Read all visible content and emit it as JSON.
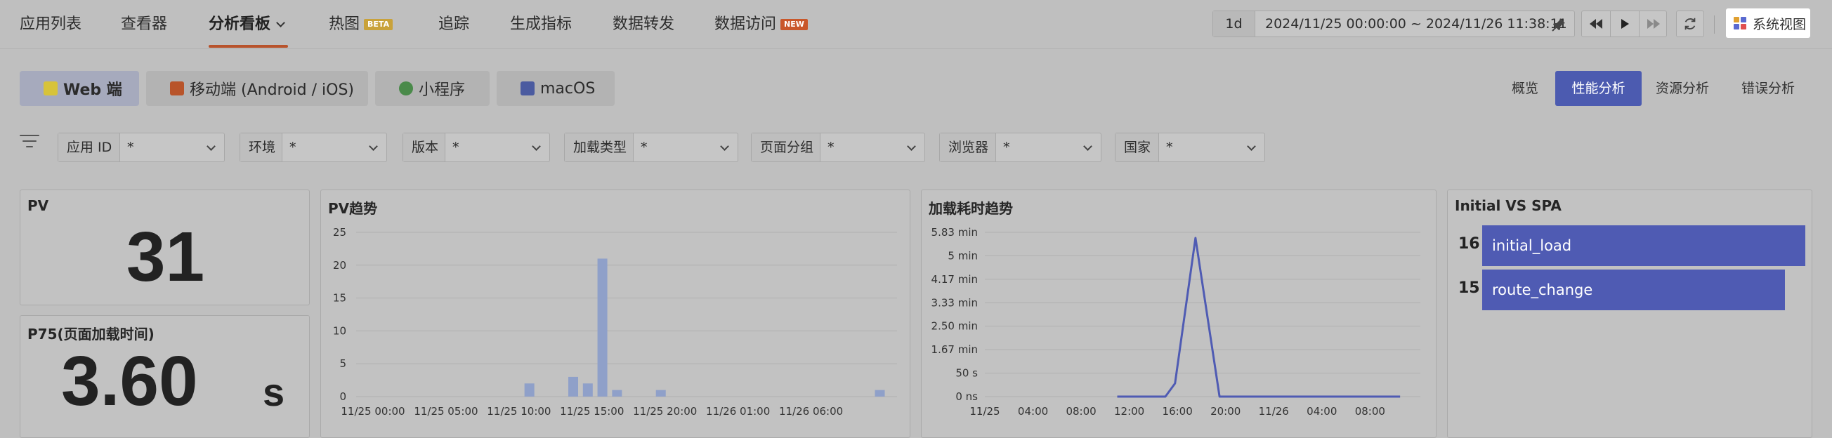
{
  "nav": {
    "items": [
      {
        "label": "应用列表"
      },
      {
        "label": "查看器"
      },
      {
        "label": "分析看板"
      },
      {
        "label": "热图",
        "badge": "BETA"
      },
      {
        "label": "追踪"
      },
      {
        "label": "生成指标"
      },
      {
        "label": "数据转发"
      },
      {
        "label": "数据访问",
        "badge": "NEW"
      }
    ],
    "active": "分析看板"
  },
  "time_range": {
    "preset": "1d",
    "text": "2024/11/25 00:00:00 ~ 2024/11/26 11:38:11"
  },
  "system_view_label": "系统视图",
  "platform_tabs": [
    {
      "label": "Web 端",
      "icon": "js-icon",
      "color": "#d7c33a"
    },
    {
      "label": "移动端 (Android / iOS)",
      "icon": "mobile-icon",
      "color": "#b8542a"
    },
    {
      "label": "小程序",
      "icon": "miniprogram-icon",
      "color": "#4a8a4a"
    },
    {
      "label": "macOS",
      "icon": "macos-icon",
      "color": "#4b5ba0"
    }
  ],
  "analysis_tabs": [
    {
      "label": "概览"
    },
    {
      "label": "性能分析"
    },
    {
      "label": "资源分析"
    },
    {
      "label": "错误分析"
    }
  ],
  "filters": [
    {
      "label": "应用 ID",
      "value": "*"
    },
    {
      "label": "环境",
      "value": "*"
    },
    {
      "label": "版本",
      "value": "*"
    },
    {
      "label": "加载类型",
      "value": "*"
    },
    {
      "label": "页面分组",
      "value": "*"
    },
    {
      "label": "浏览器",
      "value": "*"
    },
    {
      "label": "国家",
      "value": "*"
    }
  ],
  "pv_card": {
    "title": "PV",
    "value": "31"
  },
  "p75_card": {
    "title": "P75(页面加载时间)",
    "value": "3.60",
    "unit": "s"
  },
  "charts": {
    "pv_trend": {
      "title": "PV趋势"
    },
    "load_trend": {
      "title": "加载耗时趋势"
    },
    "ivs": {
      "title": "Initial VS SPA"
    }
  },
  "chart_data": [
    {
      "type": "bar",
      "title": "PV趋势",
      "x_tick_labels": [
        "11/25 00:00",
        "11/25 05:00",
        "11/25 10:00",
        "11/25 15:00",
        "11/25 20:00",
        "11/26 01:00",
        "11/26 06:00"
      ],
      "y_ticks": [
        0,
        5,
        10,
        15,
        20,
        25
      ],
      "ylim": [
        0,
        25
      ],
      "x_range_hours": [
        0,
        35.6
      ],
      "bars": [
        {
          "x_hour": 11,
          "value": 2
        },
        {
          "x_hour": 14,
          "value": 3
        },
        {
          "x_hour": 15,
          "value": 2
        },
        {
          "x_hour": 16,
          "value": 21
        },
        {
          "x_hour": 17,
          "value": 1
        },
        {
          "x_hour": 20,
          "value": 1
        },
        {
          "x_hour": 35,
          "value": 1
        }
      ],
      "color": "#8fa0c9",
      "grid": true
    },
    {
      "type": "line",
      "title": "加载耗时趋势",
      "x_tick_labels": [
        "11/25",
        "04:00",
        "08:00",
        "12:00",
        "16:00",
        "20:00",
        "11/26",
        "04:00",
        "08:00"
      ],
      "y_tick_labels": [
        "0 ns",
        "50 s",
        "1.67 min",
        "2.50 min",
        "3.33 min",
        "4.17 min",
        "5 min",
        "5.83 min"
      ],
      "y_ticks_seconds": [
        0,
        50,
        100,
        150,
        200,
        250,
        300,
        350
      ],
      "ylim_seconds": [
        0,
        350
      ],
      "x_range_hours": [
        0,
        35.6
      ],
      "points": [
        {
          "x_hour": 11,
          "y": 0
        },
        {
          "x_hour": 15,
          "y": 0
        },
        {
          "x_hour": 15.8,
          "y": 28
        },
        {
          "x_hour": 17.5,
          "y": 338
        },
        {
          "x_hour": 19.5,
          "y": 0
        },
        {
          "x_hour": 34.5,
          "y": 0
        }
      ],
      "color": "#4f5bb3",
      "grid": true
    },
    {
      "type": "bar",
      "title": "Initial VS SPA",
      "categories": [
        "initial_load",
        "route_change"
      ],
      "values": [
        16,
        15
      ],
      "orientation": "horizontal",
      "color": "#4f5bb3"
    }
  ]
}
